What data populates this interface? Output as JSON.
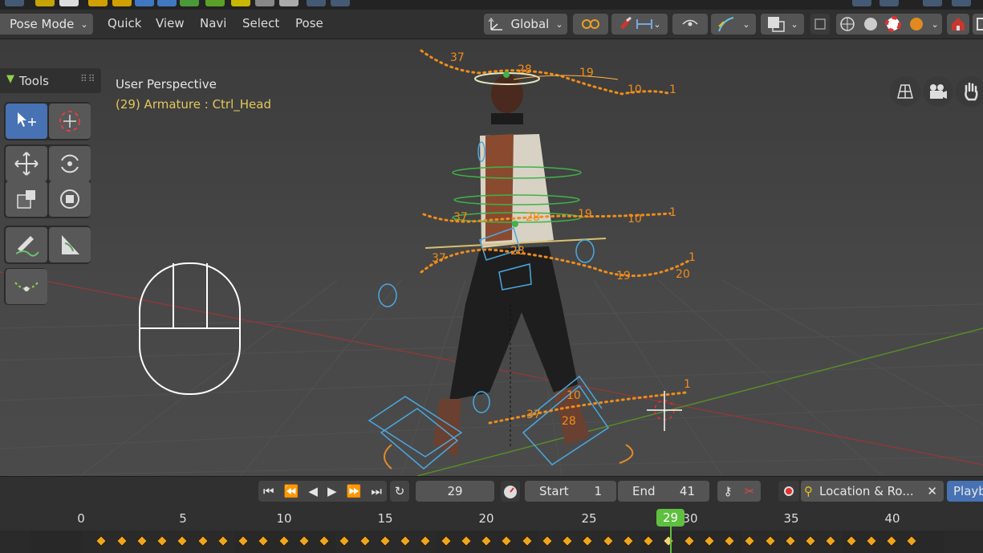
{
  "header": {
    "mode_label": "Pose Mode",
    "menus": [
      "Quick",
      "View",
      "Navi",
      "Select",
      "Pose"
    ],
    "orientation_label": "Global"
  },
  "viewport": {
    "view_name": "User Perspective",
    "object_info": "(29) Armature : Ctrl_Head",
    "tools_label": "Tools",
    "motion_path_labels": {
      "head": [
        "37",
        "28",
        "19",
        "10",
        "1"
      ],
      "chest": [
        "37",
        "28",
        "19",
        "10",
        "1"
      ],
      "hips": [
        "37",
        "28",
        "19",
        "20",
        "1"
      ],
      "feet": [
        "10",
        "37",
        "28",
        "1"
      ]
    }
  },
  "timeline": {
    "current_frame": "29",
    "start_label": "Start",
    "start_value": "1",
    "end_label": "End",
    "end_value": "41",
    "keying_set": "Location & Ro...",
    "playback_label": "Playb",
    "ruler_ticks": [
      "0",
      "5",
      "10",
      "15",
      "20",
      "25",
      "30",
      "35",
      "40"
    ],
    "playhead_frame": "29",
    "keyframes": [
      1,
      2,
      3,
      4,
      5,
      6,
      7,
      8,
      9,
      10,
      11,
      12,
      13,
      14,
      15,
      16,
      17,
      18,
      19,
      20,
      21,
      22,
      23,
      24,
      25,
      26,
      27,
      28,
      29,
      30,
      31,
      32,
      33,
      34,
      35,
      36,
      37,
      38,
      39,
      40,
      41
    ]
  },
  "colors": {
    "accent": "#4772b3",
    "keyframe": "#f0a51f",
    "playhead": "#5fbf3f",
    "motion_path": "#f08c1a",
    "info_yellow": "#e4c75c"
  }
}
